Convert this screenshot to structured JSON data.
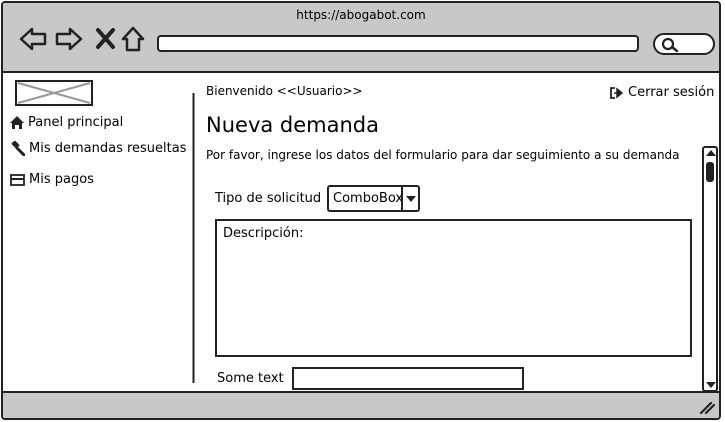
{
  "browser": {
    "url": "https://abogabot.com",
    "icons": [
      "back-icon",
      "forward-icon",
      "close-icon",
      "home-icon",
      "search-icon",
      "resize-icon"
    ]
  },
  "sidebar": {
    "items": [
      {
        "label": "Panel principal",
        "icon": "home-icon"
      },
      {
        "label": "Mis demandas resueltas",
        "icon": "gavel-icon"
      },
      {
        "label": "Mis pagos",
        "icon": "credit-card-icon"
      }
    ]
  },
  "header": {
    "welcome": "Bienvenido <<Usuario>>",
    "logout": "Cerrar sesión"
  },
  "main": {
    "title": "Nueva demanda",
    "intro": "Por favor, ingrese los datos del formulario para dar seguimiento a su demanda",
    "request_type_label": "Tipo de solicitud",
    "combo_value": "ComboBox",
    "description_label": "Descripción:",
    "some_text_label": "Some text"
  }
}
